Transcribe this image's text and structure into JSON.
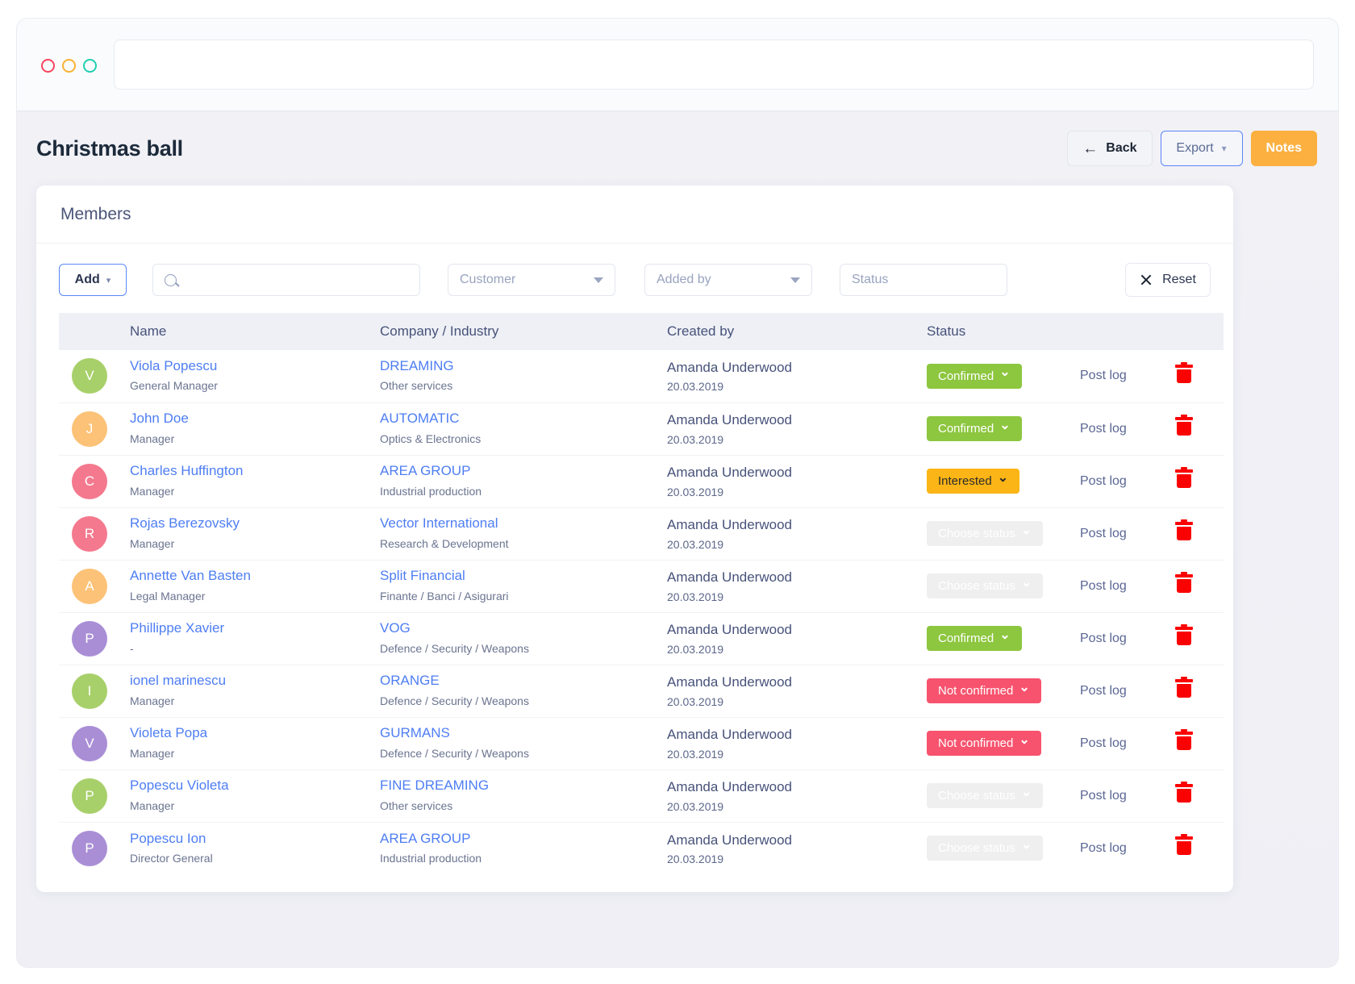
{
  "window": {
    "traffic_lights": [
      "red",
      "yellow",
      "green"
    ],
    "url_value": ""
  },
  "header": {
    "title": "Christmas ball",
    "back_label": "Back",
    "export_label": "Export",
    "notes_label": "Notes"
  },
  "card": {
    "title": "Members"
  },
  "filters": {
    "add_label": "Add",
    "search_value": "",
    "search_placeholder": "",
    "customer_label": "Customer",
    "added_by_label": "Added by",
    "status_label": "Status",
    "reset_label": "Reset"
  },
  "table": {
    "columns": [
      "",
      "Name",
      "Company / Industry",
      "Created by",
      "Status",
      "",
      ""
    ],
    "post_log_label": "Post log",
    "rows": [
      {
        "initial": "V",
        "avatar_color": "#a8d06a",
        "name": "Viola Popescu",
        "role": "General Manager",
        "company": "DREAMING",
        "industry": "Other services",
        "created_by": "Amanda Underwood",
        "created_date": "20.03.2019",
        "status": "Confirmed",
        "status_kind": "confirmed"
      },
      {
        "initial": "J",
        "avatar_color": "#fcc277",
        "name": "John Doe",
        "role": "Manager",
        "company": "AUTOMATIC",
        "industry": "Optics & Electronics",
        "created_by": "Amanda Underwood",
        "created_date": "20.03.2019",
        "status": "Confirmed",
        "status_kind": "confirmed"
      },
      {
        "initial": "C",
        "avatar_color": "#f4798e",
        "name": "Charles Huffington",
        "role": "Manager",
        "company": "AREA GROUP",
        "industry": "Industrial production",
        "created_by": "Amanda Underwood",
        "created_date": "20.03.2019",
        "status": "Interested",
        "status_kind": "interested"
      },
      {
        "initial": "R",
        "avatar_color": "#f4798e",
        "name": "Rojas Berezovsky",
        "role": "Manager",
        "company": "Vector International",
        "industry": "Research & Development",
        "created_by": "Amanda Underwood",
        "created_date": "20.03.2019",
        "status": "Choose status",
        "status_kind": "choose"
      },
      {
        "initial": "A",
        "avatar_color": "#fcc277",
        "name": "Annette Van Basten",
        "role": "Legal Manager",
        "company": "Split Financial",
        "industry": "Finante / Banci / Asigurari",
        "created_by": "Amanda Underwood",
        "created_date": "20.03.2019",
        "status": "Choose status",
        "status_kind": "choose"
      },
      {
        "initial": "P",
        "avatar_color": "#a98ed6",
        "name": "Phillippe Xavier",
        "role": "-",
        "company": "VOG",
        "industry": "Defence / Security / Weapons",
        "created_by": "Amanda Underwood",
        "created_date": "20.03.2019",
        "status": "Confirmed",
        "status_kind": "confirmed"
      },
      {
        "initial": "I",
        "avatar_color": "#a8d06a",
        "name": "ionel marinescu",
        "role": "Manager",
        "company": "ORANGE",
        "industry": "Defence / Security / Weapons",
        "created_by": "Amanda Underwood",
        "created_date": "20.03.2019",
        "status": "Not confirmed",
        "status_kind": "notconfirmed"
      },
      {
        "initial": "V",
        "avatar_color": "#a98ed6",
        "name": "Violeta Popa",
        "role": "Manager",
        "company": "GURMANS",
        "industry": "Defence / Security / Weapons",
        "created_by": "Amanda Underwood",
        "created_date": "20.03.2019",
        "status": "Not confirmed",
        "status_kind": "notconfirmed"
      },
      {
        "initial": "P",
        "avatar_color": "#a8d06a",
        "name": "Popescu Violeta",
        "role": "Manager",
        "company": "FINE DREAMING",
        "industry": "Other services",
        "created_by": "Amanda Underwood",
        "created_date": "20.03.2019",
        "status": "Choose status",
        "status_kind": "choose"
      },
      {
        "initial": "P",
        "avatar_color": "#a98ed6",
        "name": "Popescu Ion",
        "role": "Director General",
        "company": "AREA GROUP",
        "industry": "Industrial production",
        "created_by": "Amanda Underwood",
        "created_date": "20.03.2019",
        "status": "Choose status",
        "status_kind": "choose"
      }
    ]
  },
  "colors": {
    "accent_blue": "#4e7ef3",
    "accent_orange": "#fbb040",
    "status_confirmed": "#8dc63f",
    "status_interested": "#fbb516",
    "status_choose": "#9299c9",
    "status_notconfirmed": "#f7536e",
    "trash_red": "#fb0202"
  }
}
